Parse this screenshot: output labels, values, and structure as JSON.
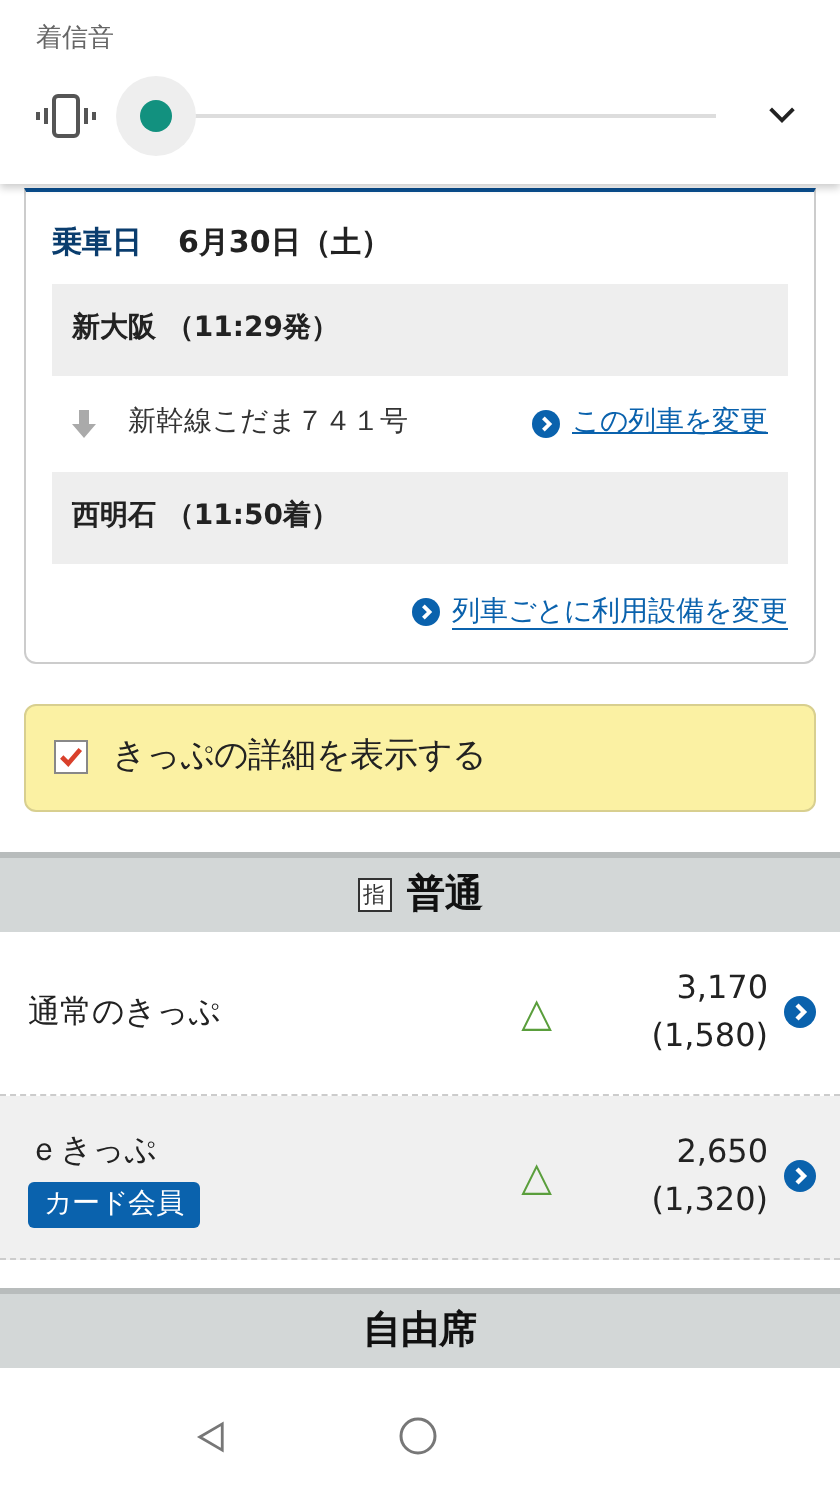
{
  "volume_panel": {
    "title": "着信音",
    "slider": {
      "level": 0.0
    }
  },
  "trip": {
    "date_label": "乗車日",
    "date": "6月30日（土）",
    "departure": "新大阪 （11:29発）",
    "train": "新幹線こだま７４１号",
    "change_train_link": "この列車を変更",
    "arrival": "西明石 （11:50着）",
    "change_facility_link": "列車ごとに利用設備を変更"
  },
  "details_toggle": {
    "label": "きっぷの詳細を表示する",
    "checked": true
  },
  "sections": [
    {
      "badge": "指",
      "title": "普通",
      "tickets": [
        {
          "name": "通常のきっぷ",
          "availability": "△",
          "price": "3,170",
          "child_price": "(1,580)"
        },
        {
          "name": "ｅきっぷ",
          "tag": "カード会員",
          "availability": "△",
          "price": "2,650",
          "child_price": "(1,320)"
        }
      ]
    },
    {
      "title": "自由席"
    }
  ]
}
